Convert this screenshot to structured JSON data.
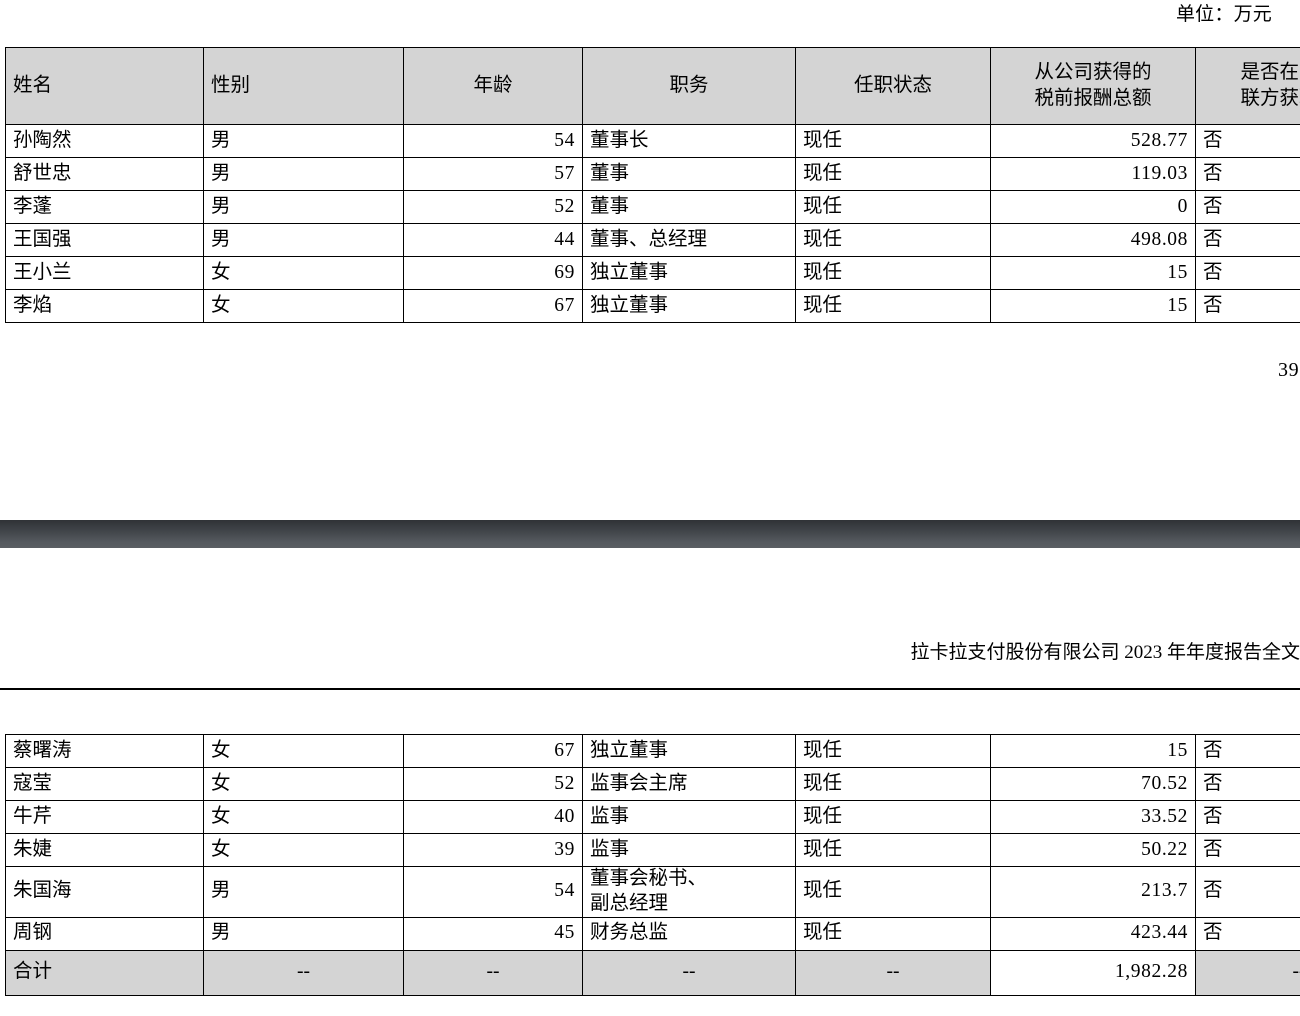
{
  "page_one": {
    "unit_label": "单位：万元",
    "page_number_fragment": "39",
    "table": {
      "columns": [
        {
          "key": "name",
          "label": "姓名"
        },
        {
          "key": "gender",
          "label": "性别"
        },
        {
          "key": "age",
          "label": "年龄"
        },
        {
          "key": "title",
          "label": "职务"
        },
        {
          "key": "status",
          "label": "任职状态"
        },
        {
          "key": "pay_line1",
          "label": "从公司获得的"
        },
        {
          "key": "pay_line2",
          "label": "税前报酬总额"
        },
        {
          "key": "related_line1",
          "label": "是否在公司关"
        },
        {
          "key": "related_line2",
          "label": "联方获取报酬"
        }
      ],
      "rows": [
        {
          "name": "孙陶然",
          "gender": "男",
          "age": "54",
          "title": "董事长",
          "status": "现任",
          "pay": "528.77",
          "related": "否"
        },
        {
          "name": "舒世忠",
          "gender": "男",
          "age": "57",
          "title": "董事",
          "status": "现任",
          "pay": "119.03",
          "related": "否"
        },
        {
          "name": "李蓬",
          "gender": "男",
          "age": "52",
          "title": "董事",
          "status": "现任",
          "pay": "0",
          "related": "否"
        },
        {
          "name": "王国强",
          "gender": "男",
          "age": "44",
          "title": "董事、总经理",
          "status": "现任",
          "pay": "498.08",
          "related": "否"
        },
        {
          "name": "王小兰",
          "gender": "女",
          "age": "69",
          "title": "独立董事",
          "status": "现任",
          "pay": "15",
          "related": "否"
        },
        {
          "name": "李焰",
          "gender": "女",
          "age": "67",
          "title": "独立董事",
          "status": "现任",
          "pay": "15",
          "related": "否"
        }
      ]
    }
  },
  "page_two": {
    "running_head": "拉卡拉支付股份有限公司 2023 年年度报告全文",
    "table": {
      "rows": [
        {
          "name": "蔡曙涛",
          "gender": "女",
          "age": "67",
          "title": "独立董事",
          "title2": "",
          "status": "现任",
          "pay": "15",
          "related": "否"
        },
        {
          "name": "寇莹",
          "gender": "女",
          "age": "52",
          "title": "监事会主席",
          "title2": "",
          "status": "现任",
          "pay": "70.52",
          "related": "否"
        },
        {
          "name": "牛芹",
          "gender": "女",
          "age": "40",
          "title": "监事",
          "title2": "",
          "status": "现任",
          "pay": "33.52",
          "related": "否"
        },
        {
          "name": "朱婕",
          "gender": "女",
          "age": "39",
          "title": "监事",
          "title2": "",
          "status": "现任",
          "pay": "50.22",
          "related": "否"
        },
        {
          "name": "朱国海",
          "gender": "男",
          "age": "54",
          "title": "董事会秘书、",
          "title2": "副总经理",
          "status": "现任",
          "pay": "213.7",
          "related": "否"
        },
        {
          "name": "周钢",
          "gender": "男",
          "age": "45",
          "title": "财务总监",
          "title2": "",
          "status": "现任",
          "pay": "423.44",
          "related": "否"
        }
      ],
      "total_row": {
        "name": "合计",
        "gender": "--",
        "age": "--",
        "title": "--",
        "status": "--",
        "pay": "1,982.28",
        "related": "--"
      }
    }
  },
  "style": {
    "header_fill": "#d4d4d4",
    "total_fill": "#d4d4d4",
    "border_color": "#000000",
    "page_gap_top": "#2f3236",
    "page_gap_bottom": "#5a5e63"
  }
}
